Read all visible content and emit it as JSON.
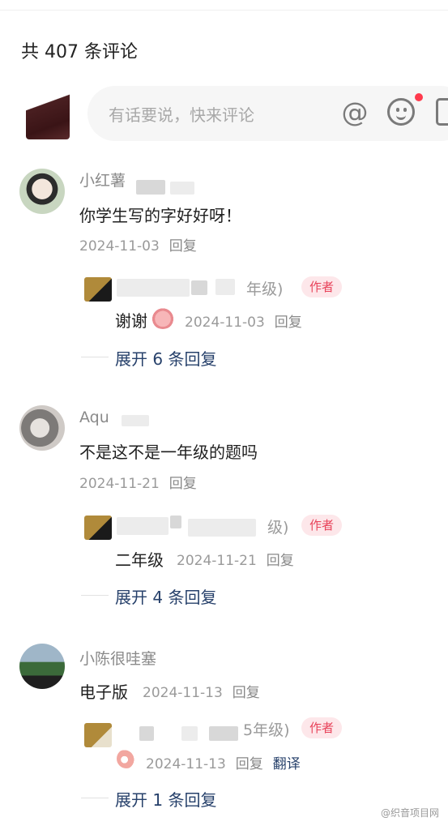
{
  "header": {
    "count_text": "共 407 条评论"
  },
  "composer": {
    "placeholder": "有话要说，快来评论",
    "icons": [
      "at-icon",
      "emoji-icon",
      "image-icon"
    ]
  },
  "comments": [
    {
      "user": "小红薯",
      "text": "你学生写的字好好呀！",
      "date": "2024-11-03",
      "reply_label": "回复",
      "author_reply": {
        "name_fragment": "年级)",
        "tag": "作者",
        "text": "谢谢",
        "date": "2024-11-03",
        "reply_label": "回复"
      },
      "expand": "展开 6 条回复"
    },
    {
      "user": "Aqu",
      "text": "不是这不是一年级的题吗",
      "date": "2024-11-21",
      "reply_label": "回复",
      "author_reply": {
        "name_fragment": "级)",
        "tag": "作者",
        "text": "二年级",
        "date": "2024-11-21",
        "reply_label": "回复"
      },
      "expand": "展开 4 条回复"
    },
    {
      "user": "小陈很哇塞",
      "text": "电子版",
      "date": "2024-11-13",
      "reply_label": "回复",
      "author_reply": {
        "name_fragment": "5年级)",
        "tag": "作者",
        "text": "",
        "date": "2024-11-13",
        "reply_label": "回复",
        "translate_label": "翻译"
      },
      "expand": "展开 1 条回复"
    }
  ],
  "watermark": "@织音项目网",
  "colors": {
    "author_tag_bg": "#fde7ea",
    "author_tag_text": "#e8435a",
    "expand_text": "#27416b",
    "notify_dot": "#ff3a4d"
  }
}
